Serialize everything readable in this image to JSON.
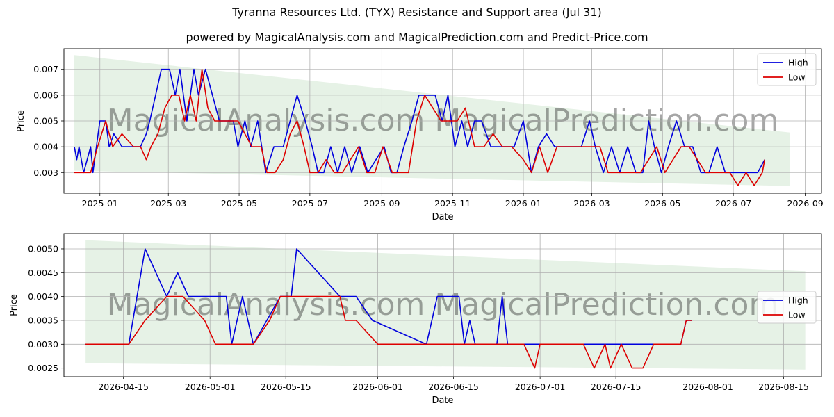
{
  "page": {
    "title": "Tyranna Resources Ltd. (TYX) Resistance and Support area (Jul 31)",
    "subtitle": "powered by MagicalAnalysis.com and MagicalPrediction.com and Predict-Price.com"
  },
  "watermark": {
    "top": "MagicalAnalysis.com MagicalPrediction.com",
    "bottom": "MagicalAnalysis.com MagicalPrediction.com"
  },
  "colors": {
    "high": "#0000dd",
    "low": "#dd0000",
    "band": "#e6f2e6",
    "grid": "#b0b0b0"
  },
  "chart_data": [
    {
      "type": "line",
      "xlabel": "Date",
      "ylabel": "Price",
      "xlim": [
        "2024-12-01",
        "2026-09-15"
      ],
      "ylim": [
        0.0022,
        0.0078
      ],
      "xticks": [
        "2025-01",
        "2025-03",
        "2025-05",
        "2025-07",
        "2025-09",
        "2025-11",
        "2026-01",
        "2026-03",
        "2026-05",
        "2026-07",
        "2026-09"
      ],
      "xtick_dates": [
        "2025-01-01",
        "2025-03-01",
        "2025-05-01",
        "2025-07-01",
        "2025-09-01",
        "2025-11-01",
        "2026-01-01",
        "2026-03-01",
        "2026-05-01",
        "2026-07-01",
        "2026-09-01"
      ],
      "yticks": [
        0.003,
        0.004,
        0.005,
        0.006,
        0.007
      ],
      "ytick_labels": [
        "0.003",
        "0.004",
        "0.005",
        "0.006",
        "0.007"
      ],
      "band": {
        "x": [
          "2024-12-10",
          "2026-08-19"
        ],
        "upper": [
          0.00755,
          0.00455
        ],
        "lower": [
          0.00307,
          0.00248
        ]
      },
      "legend": "top-right",
      "grid": true,
      "series": [
        {
          "name": "High",
          "x": [
            "2024-12-10",
            "2024-12-12",
            "2024-12-14",
            "2024-12-18",
            "2024-12-24",
            "2024-12-26",
            "2025-01-01",
            "2025-01-06",
            "2025-01-09",
            "2025-01-13",
            "2025-01-20",
            "2025-01-30",
            "2025-02-05",
            "2025-02-10",
            "2025-02-13",
            "2025-02-18",
            "2025-02-23",
            "2025-03-02",
            "2025-03-07",
            "2025-03-11",
            "2025-03-17",
            "2025-03-23",
            "2025-03-27",
            "2025-04-02",
            "2025-04-08",
            "2025-04-14",
            "2025-04-20",
            "2025-04-26",
            "2025-04-30",
            "2025-05-06",
            "2025-05-11",
            "2025-05-17",
            "2025-05-24",
            "2025-05-31",
            "2025-06-08",
            "2025-06-14",
            "2025-06-20",
            "2025-06-27",
            "2025-07-03",
            "2025-07-08",
            "2025-07-13",
            "2025-07-19",
            "2025-07-25",
            "2025-07-31",
            "2025-08-06",
            "2025-08-13",
            "2025-08-20",
            "2025-08-27",
            "2025-09-03",
            "2025-09-09",
            "2025-09-14",
            "2025-09-20",
            "2025-09-27",
            "2025-10-03",
            "2025-10-10",
            "2025-10-17",
            "2025-10-23",
            "2025-10-28",
            "2025-11-03",
            "2025-11-09",
            "2025-11-14",
            "2025-11-20",
            "2025-11-26",
            "2025-12-04",
            "2025-12-10",
            "2025-12-17",
            "2025-12-24",
            "2026-01-01",
            "2026-01-08",
            "2026-01-14",
            "2026-01-21",
            "2026-01-28",
            "2026-02-04",
            "2026-02-12",
            "2026-02-20",
            "2026-02-27",
            "2026-03-04",
            "2026-03-11",
            "2026-03-18",
            "2026-03-25",
            "2026-04-01",
            "2026-04-08",
            "2026-04-14",
            "2026-04-19",
            "2026-04-24",
            "2026-04-30",
            "2026-05-06",
            "2026-05-13",
            "2026-05-20",
            "2026-05-27",
            "2026-06-03",
            "2026-06-10",
            "2026-06-17",
            "2026-06-24",
            "2026-07-01",
            "2026-07-08",
            "2026-07-15",
            "2026-07-22",
            "2026-07-28"
          ],
          "values": [
            0.004,
            0.0035,
            0.004,
            0.003,
            0.004,
            0.003,
            0.005,
            0.005,
            0.004,
            0.0045,
            0.004,
            0.004,
            0.004,
            0.0045,
            0.005,
            0.006,
            0.007,
            0.007,
            0.006,
            0.007,
            0.005,
            0.007,
            0.006,
            0.007,
            0.006,
            0.005,
            0.005,
            0.005,
            0.004,
            0.005,
            0.004,
            0.005,
            0.003,
            0.004,
            0.004,
            0.005,
            0.006,
            0.005,
            0.004,
            0.003,
            0.003,
            0.004,
            0.003,
            0.004,
            0.003,
            0.004,
            0.003,
            0.0035,
            0.004,
            0.003,
            0.003,
            0.004,
            0.005,
            0.006,
            0.006,
            0.006,
            0.005,
            0.006,
            0.004,
            0.005,
            0.004,
            0.005,
            0.005,
            0.004,
            0.004,
            0.004,
            0.004,
            0.005,
            0.003,
            0.004,
            0.0045,
            0.004,
            0.004,
            0.004,
            0.004,
            0.005,
            0.004,
            0.003,
            0.004,
            0.003,
            0.004,
            0.003,
            0.003,
            0.005,
            0.004,
            0.003,
            0.004,
            0.005,
            0.004,
            0.004,
            0.003,
            0.003,
            0.004,
            0.003,
            0.003,
            0.003,
            0.003,
            0.003,
            0.0035
          ]
        },
        {
          "name": "Low",
          "x": [
            "2024-12-10",
            "2024-12-18",
            "2024-12-24",
            "2024-12-30",
            "2025-01-06",
            "2025-01-12",
            "2025-01-20",
            "2025-01-30",
            "2025-02-05",
            "2025-02-10",
            "2025-02-14",
            "2025-02-20",
            "2025-02-26",
            "2025-03-04",
            "2025-03-10",
            "2025-03-15",
            "2025-03-20",
            "2025-03-25",
            "2025-03-30",
            "2025-04-04",
            "2025-04-10",
            "2025-04-20",
            "2025-04-30",
            "2025-05-06",
            "2025-05-12",
            "2025-05-20",
            "2025-05-25",
            "2025-06-01",
            "2025-06-08",
            "2025-06-14",
            "2025-06-20",
            "2025-06-26",
            "2025-07-01",
            "2025-07-08",
            "2025-07-15",
            "2025-07-22",
            "2025-07-29",
            "2025-08-05",
            "2025-08-12",
            "2025-08-19",
            "2025-08-26",
            "2025-09-02",
            "2025-09-10",
            "2025-09-17",
            "2025-09-24",
            "2025-10-01",
            "2025-10-08",
            "2025-10-15",
            "2025-10-22",
            "2025-10-29",
            "2025-11-05",
            "2025-11-12",
            "2025-11-20",
            "2025-11-28",
            "2025-12-06",
            "2025-12-14",
            "2025-12-22",
            "2026-01-01",
            "2026-01-08",
            "2026-01-15",
            "2026-01-22",
            "2026-01-30",
            "2026-02-08",
            "2026-02-18",
            "2026-02-28",
            "2026-03-08",
            "2026-03-15",
            "2026-03-22",
            "2026-03-29",
            "2026-04-05",
            "2026-04-12",
            "2026-04-19",
            "2026-04-26",
            "2026-05-03",
            "2026-05-10",
            "2026-05-17",
            "2026-05-24",
            "2026-05-31",
            "2026-06-07",
            "2026-06-14",
            "2026-06-21",
            "2026-06-28",
            "2026-07-05",
            "2026-07-12",
            "2026-07-19",
            "2026-07-26",
            "2026-07-28"
          ],
          "values": [
            0.003,
            0.003,
            0.003,
            0.004,
            0.005,
            0.004,
            0.0045,
            0.004,
            0.004,
            0.0035,
            0.004,
            0.0045,
            0.0055,
            0.006,
            0.006,
            0.005,
            0.006,
            0.005,
            0.007,
            0.0055,
            0.005,
            0.005,
            0.005,
            0.0045,
            0.004,
            0.004,
            0.003,
            0.003,
            0.0035,
            0.0045,
            0.005,
            0.004,
            0.003,
            0.003,
            0.0035,
            0.003,
            0.003,
            0.0035,
            0.004,
            0.003,
            0.003,
            0.004,
            0.003,
            0.003,
            0.003,
            0.005,
            0.006,
            0.0055,
            0.005,
            0.005,
            0.005,
            0.0055,
            0.004,
            0.004,
            0.0045,
            0.004,
            0.004,
            0.0035,
            0.003,
            0.004,
            0.003,
            0.004,
            0.004,
            0.004,
            0.004,
            0.004,
            0.003,
            0.003,
            0.003,
            0.003,
            0.003,
            0.0035,
            0.004,
            0.003,
            0.0035,
            0.004,
            0.004,
            0.0035,
            0.003,
            0.003,
            0.003,
            0.003,
            0.0025,
            0.003,
            0.0025,
            0.003,
            0.0035
          ]
        }
      ]
    },
    {
      "type": "line",
      "xlabel": "Date",
      "ylabel": "Price",
      "xlim": [
        "2026-04-04",
        "2026-08-22"
      ],
      "ylim": [
        0.00232,
        0.00532
      ],
      "xticks": [
        "2026-04-15",
        "2026-05-01",
        "2026-05-15",
        "2026-06-01",
        "2026-06-15",
        "2026-07-01",
        "2026-07-15",
        "2026-08-01",
        "2026-08-15"
      ],
      "xtick_dates": [
        "2026-04-15",
        "2026-05-01",
        "2026-05-15",
        "2026-06-01",
        "2026-06-15",
        "2026-07-01",
        "2026-07-15",
        "2026-08-01",
        "2026-08-15"
      ],
      "yticks": [
        0.0025,
        0.003,
        0.0035,
        0.004,
        0.0045,
        0.005
      ],
      "ytick_labels": [
        "0.0025",
        "0.0030",
        "0.0035",
        "0.0040",
        "0.0045",
        "0.0050"
      ],
      "band": {
        "x": [
          "2026-04-08",
          "2026-08-19"
        ],
        "upper": [
          0.00518,
          0.00453
        ],
        "lower": [
          0.0026,
          0.00247
        ]
      },
      "legend": "center-right",
      "grid": true,
      "series": [
        {
          "name": "High",
          "x": [
            "2026-04-08",
            "2026-04-16",
            "2026-04-19",
            "2026-04-23",
            "2026-04-25",
            "2026-04-27",
            "2026-05-01",
            "2026-05-04",
            "2026-05-05",
            "2026-05-07",
            "2026-05-09",
            "2026-05-14",
            "2026-05-16",
            "2026-05-17",
            "2026-05-25",
            "2026-05-28",
            "2026-05-31",
            "2026-06-10",
            "2026-06-12",
            "2026-06-16",
            "2026-06-17",
            "2026-06-18",
            "2026-06-19",
            "2026-06-23",
            "2026-06-24",
            "2026-06-25",
            "2026-06-29",
            "2026-07-02",
            "2026-07-08",
            "2026-07-10",
            "2026-07-16",
            "2026-07-21",
            "2026-07-27",
            "2026-07-28",
            "2026-07-29"
          ],
          "values": [
            0.003,
            0.003,
            0.005,
            0.004,
            0.0045,
            0.004,
            0.004,
            0.004,
            0.003,
            0.004,
            0.003,
            0.004,
            0.004,
            0.005,
            0.004,
            0.004,
            0.0035,
            0.003,
            0.004,
            0.004,
            0.003,
            0.0035,
            0.003,
            0.003,
            0.004,
            0.003,
            0.003,
            0.003,
            0.003,
            0.003,
            0.003,
            0.003,
            0.003,
            0.0035,
            0.0035
          ]
        },
        {
          "name": "Low",
          "x": [
            "2026-04-08",
            "2026-04-16",
            "2026-04-19",
            "2026-04-23",
            "2026-04-26",
            "2026-04-30",
            "2026-05-02",
            "2026-05-03",
            "2026-05-09",
            "2026-05-12",
            "2026-05-14",
            "2026-05-16",
            "2026-05-25",
            "2026-05-26",
            "2026-05-28",
            "2026-06-01",
            "2026-06-05",
            "2026-06-16",
            "2026-06-28",
            "2026-06-30",
            "2026-07-01",
            "2026-07-03",
            "2026-07-09",
            "2026-07-11",
            "2026-07-13",
            "2026-07-14",
            "2026-07-16",
            "2026-07-18",
            "2026-07-20",
            "2026-07-22",
            "2026-07-25",
            "2026-07-27",
            "2026-07-28",
            "2026-07-29"
          ],
          "values": [
            0.003,
            0.003,
            0.0035,
            0.004,
            0.004,
            0.0035,
            0.003,
            0.003,
            0.003,
            0.0035,
            0.004,
            0.004,
            0.004,
            0.0035,
            0.0035,
            0.003,
            0.003,
            0.003,
            0.003,
            0.0025,
            0.003,
            0.003,
            0.003,
            0.0025,
            0.003,
            0.0025,
            0.003,
            0.0025,
            0.0025,
            0.003,
            0.003,
            0.003,
            0.0035,
            0.0035
          ]
        }
      ]
    }
  ]
}
